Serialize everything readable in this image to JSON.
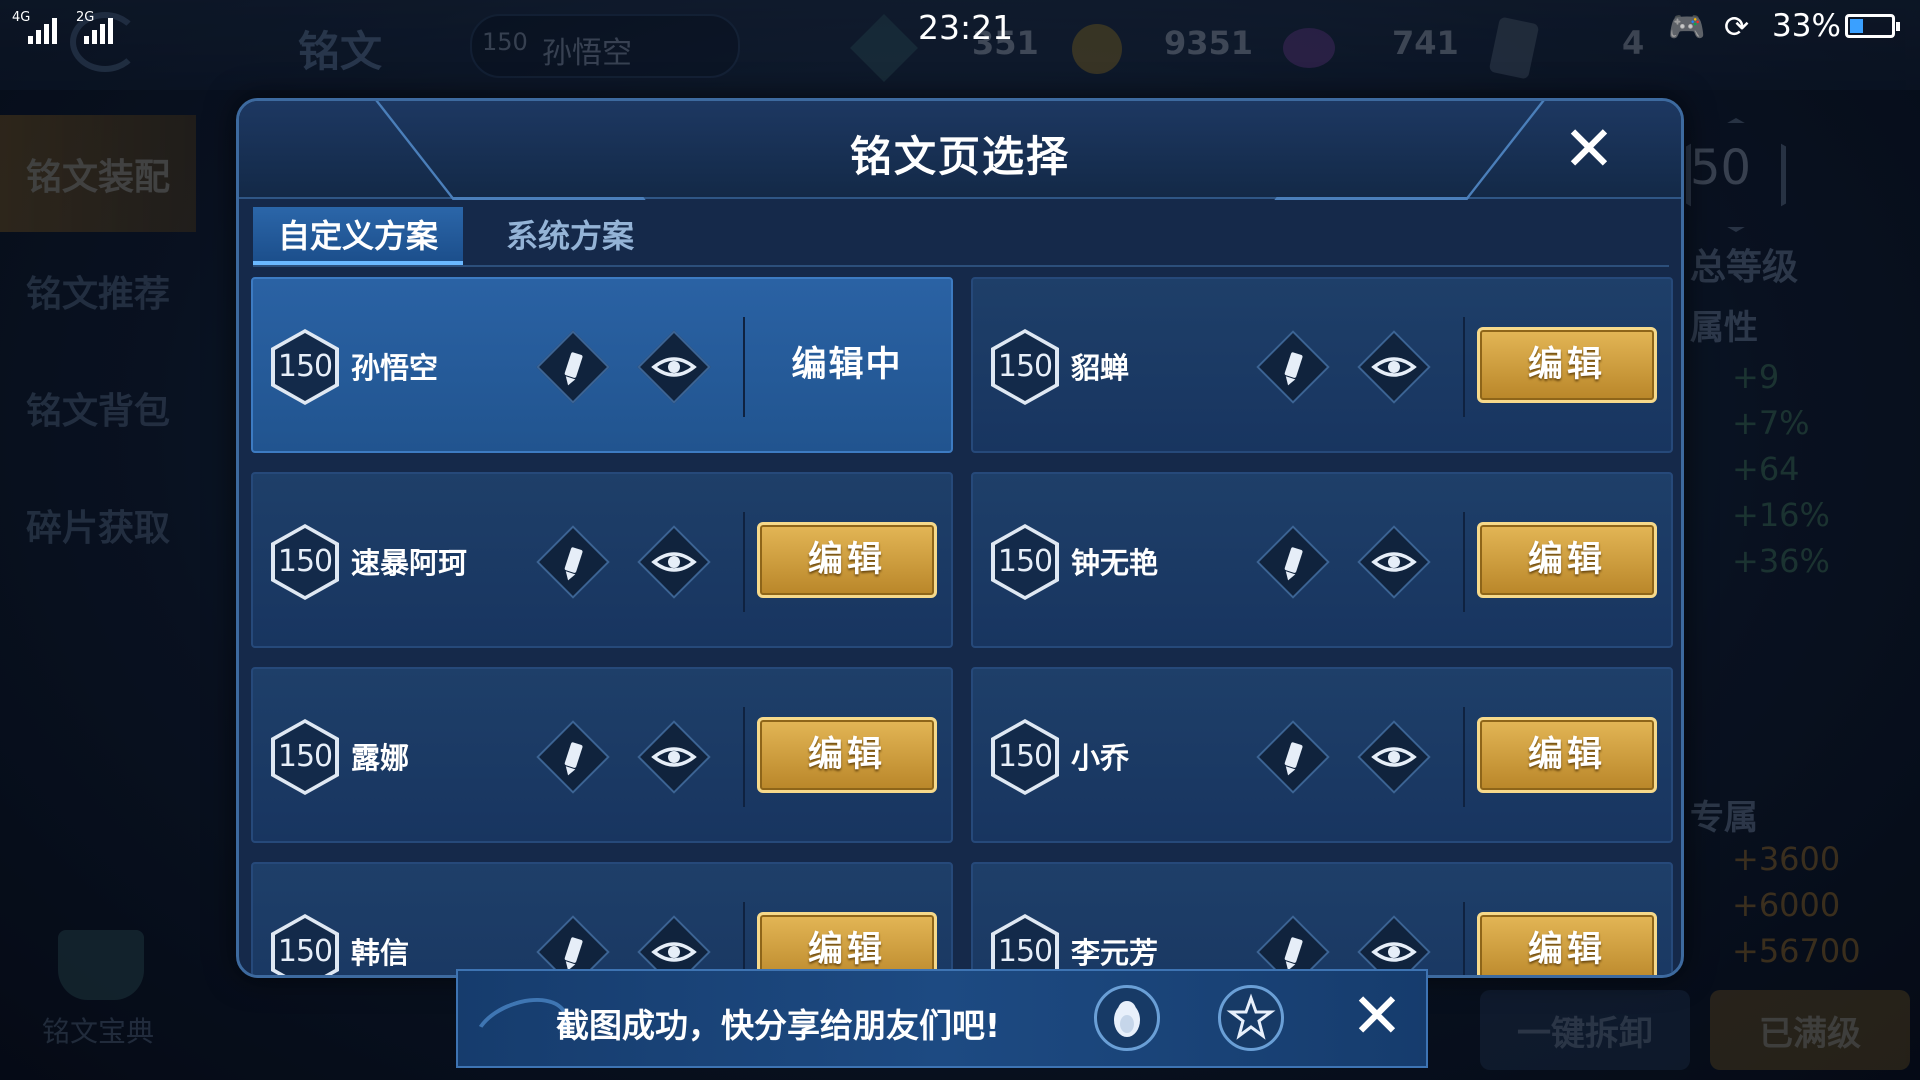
{
  "status_bar": {
    "network_1": "4G",
    "network_2": "2G",
    "time": "23:21",
    "battery_percent": "33%",
    "battery_level": 0.33
  },
  "background": {
    "page_title": "铭文",
    "hero_level": "150",
    "hero_name": "孙悟空",
    "stat_gem": "351",
    "stat_gold": "9351",
    "stat_purple": "741",
    "stat_card": "4",
    "side_nav": [
      "铭文装配",
      "铭文推荐",
      "铭文背包",
      "碎片获取"
    ],
    "side_bottom_label": "铭文宝典",
    "right_panel": {
      "level_num": "50",
      "total_level_label": "总等级",
      "attr_label": "属性",
      "attr_values": [
        "+9",
        "+7%",
        "+64",
        "+16%",
        "+36%"
      ],
      "exclusive_label": "专属",
      "exclusive_values": [
        "+3600",
        "+6000",
        "+56700"
      ],
      "btn_unload": "一键拆卸",
      "btn_maxed": "已满级"
    }
  },
  "modal": {
    "title": "铭文页选择",
    "tabs": [
      "自定义方案",
      "系统方案"
    ],
    "editing_label": "编辑中",
    "edit_label": "编辑",
    "cards": [
      {
        "level": "150",
        "name": "孙悟空",
        "selected": true
      },
      {
        "level": "150",
        "name": "貂蝉",
        "selected": false
      },
      {
        "level": "150",
        "name": "速暴阿珂",
        "selected": false
      },
      {
        "level": "150",
        "name": "钟无艳",
        "selected": false
      },
      {
        "level": "150",
        "name": "露娜",
        "selected": false
      },
      {
        "level": "150",
        "name": "小乔",
        "selected": false
      },
      {
        "level": "150",
        "name": "韩信",
        "selected": false
      },
      {
        "level": "150",
        "name": "李元芳",
        "selected": false
      }
    ]
  },
  "toast": {
    "message": "截图成功，快分享给朋友们吧!"
  },
  "icons": {
    "rename": "pencil-icon",
    "preview": "eye-icon",
    "close": "close-icon",
    "share_qq": "qq-penguin-icon",
    "share_qzone": "qzone-star-icon"
  },
  "colors": {
    "gold_button": "#d4a544",
    "selected_card": "#2a62a4",
    "card": "#1e3f69"
  }
}
